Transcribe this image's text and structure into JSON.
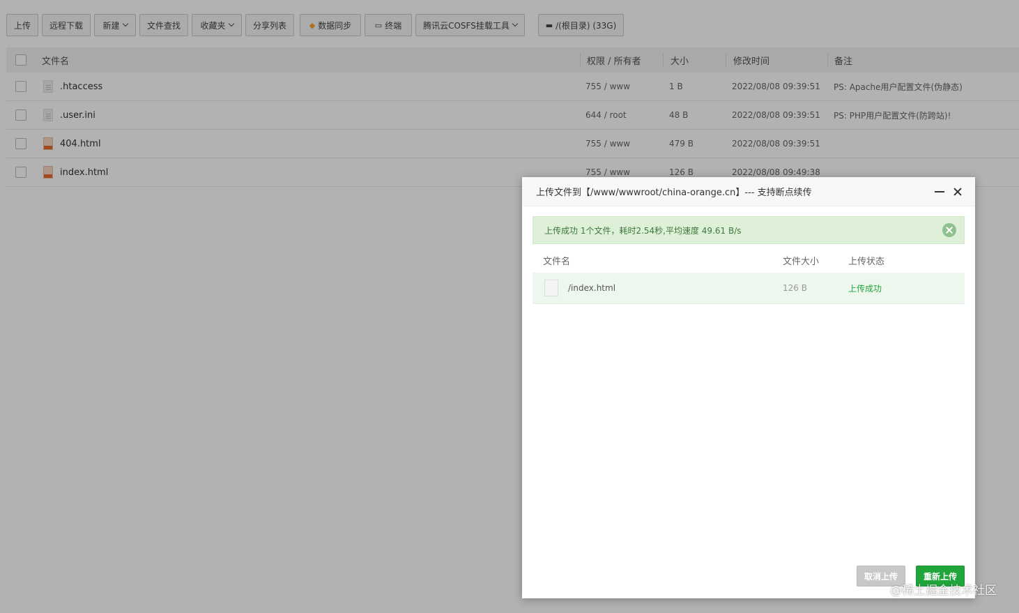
{
  "toolbar": {
    "upload": "上传",
    "remote_download": "远程下载",
    "new": "新建",
    "file_search": "文件查找",
    "favorites": "收藏夹",
    "share_list": "分享列表",
    "data_sync": "数据同步",
    "terminal": "终端",
    "cosfs": "腾讯云COSFS挂载工具",
    "root_dir": "/(根目录) (33G)"
  },
  "table": {
    "headers": {
      "name": "文件名",
      "perm": "权限 / 所有者",
      "size": "大小",
      "mtime": "修改时间",
      "note": "备注"
    },
    "rows": [
      {
        "name": ".htaccess",
        "perm": "755 / www",
        "size": "1 B",
        "mtime": "2022/08/08 09:39:51",
        "note": "PS: Apache用户配置文件(伪静态)",
        "icon": "text-file-icon"
      },
      {
        "name": ".user.ini",
        "perm": "644 / root",
        "size": "48 B",
        "mtime": "2022/08/08 09:39:51",
        "note": "PS: PHP用户配置文件(防跨站)!",
        "icon": "text-file-icon"
      },
      {
        "name": "404.html",
        "perm": "755 / www",
        "size": "479 B",
        "mtime": "2022/08/08 09:39:51",
        "note": "",
        "icon": "html-file-icon"
      },
      {
        "name": "index.html",
        "perm": "755 / www",
        "size": "126 B",
        "mtime": "2022/08/08 09:49:38",
        "note": "",
        "icon": "html-file-icon"
      }
    ]
  },
  "dialog": {
    "title": "上传文件到【/www/wwwroot/china-orange.cn】--- 支持断点续传",
    "alert": "上传成功 1个文件，耗时2.54秒,平均速度 49.61 B/s",
    "headers": {
      "name": "文件名",
      "size": "文件大小",
      "status": "上传状态"
    },
    "files": [
      {
        "name": "/index.html",
        "size": "126 B",
        "status": "上传成功"
      }
    ],
    "cancel_label": "取消上传",
    "reupload_label": "重新上传"
  },
  "watermark": "@稀土掘金技术社区",
  "colors": {
    "success_green": "#20a53a",
    "alert_bg": "#dff0d8",
    "alert_text": "#3c763d",
    "html_icon": "#e8692f"
  }
}
